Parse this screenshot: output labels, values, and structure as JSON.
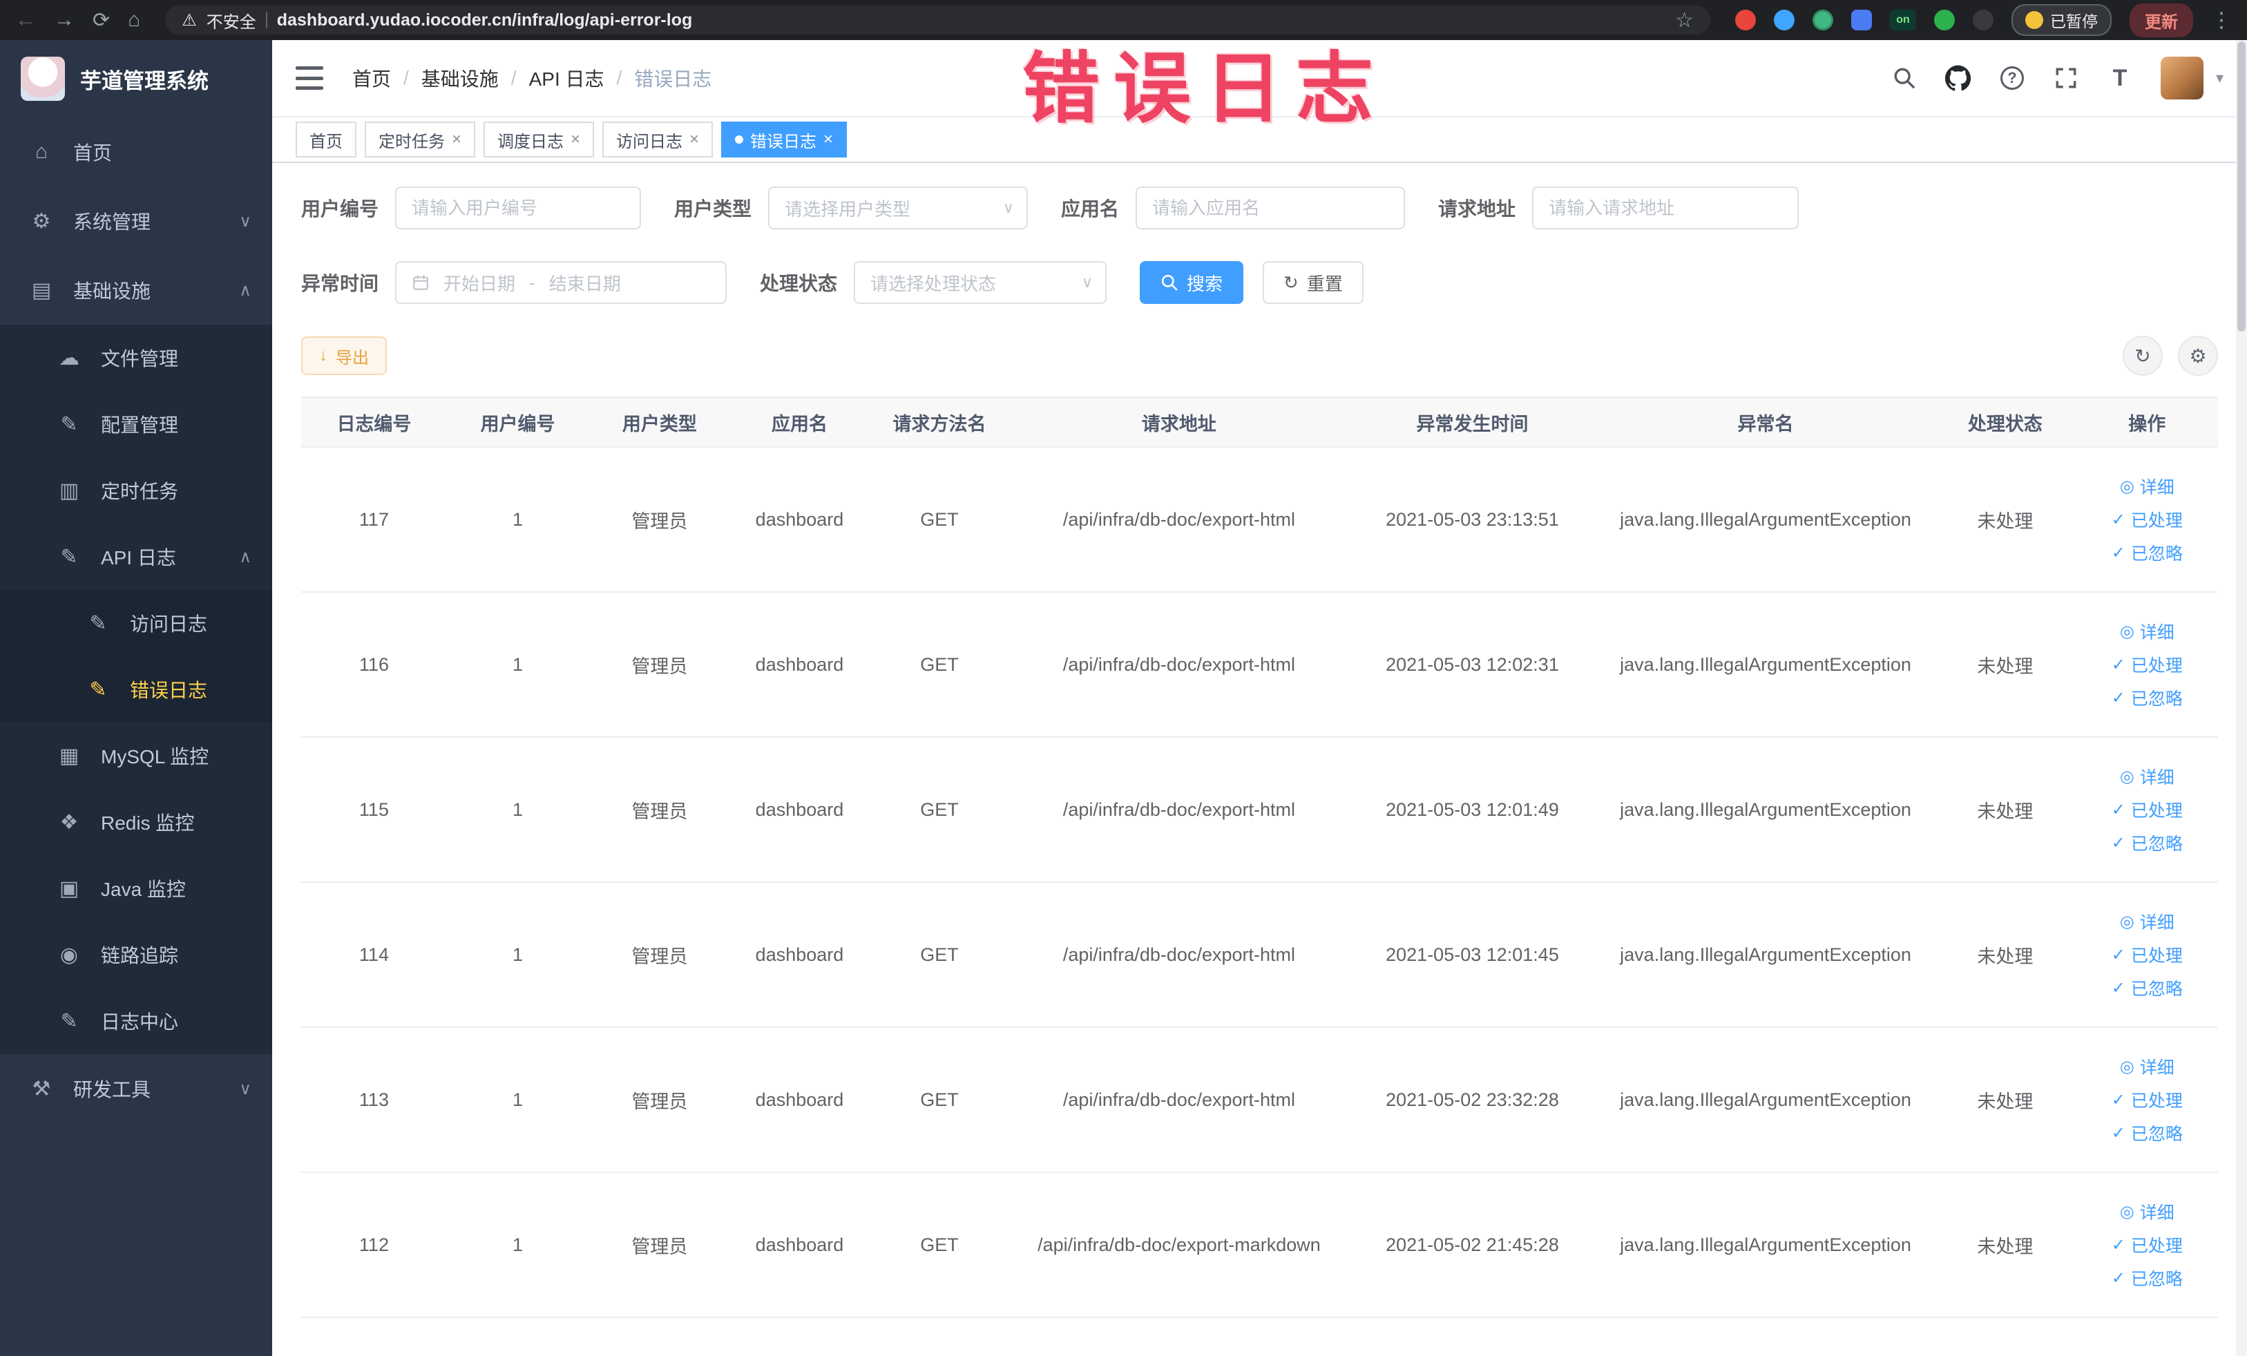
{
  "browser": {
    "security_label": "不安全",
    "url": "dashboard.yudao.iocoder.cn/infra/log/api-error-log",
    "ext_on_label": "on",
    "paused_label": "已暂停",
    "update_label": "更新"
  },
  "annotation": {
    "text": "错误日志"
  },
  "sidebar": {
    "title": "芋道管理系统",
    "items": [
      {
        "label": "首页"
      },
      {
        "label": "系统管理"
      },
      {
        "label": "基础设施"
      },
      {
        "label": "文件管理"
      },
      {
        "label": "配置管理"
      },
      {
        "label": "定时任务"
      },
      {
        "label": "API 日志"
      },
      {
        "label": "访问日志"
      },
      {
        "label": "错误日志"
      },
      {
        "label": "MySQL 监控"
      },
      {
        "label": "Redis 监控"
      },
      {
        "label": "Java 监控"
      },
      {
        "label": "链路追踪"
      },
      {
        "label": "日志中心"
      },
      {
        "label": "研发工具"
      }
    ]
  },
  "breadcrumb": {
    "items": [
      "首页",
      "基础设施",
      "API 日志",
      "错误日志"
    ],
    "separator": "/"
  },
  "tabs": [
    {
      "label": "首页"
    },
    {
      "label": "定时任务"
    },
    {
      "label": "调度日志"
    },
    {
      "label": "访问日志"
    },
    {
      "label": "错误日志"
    }
  ],
  "filters": {
    "user_id_label": "用户编号",
    "user_id_placeholder": "请输入用户编号",
    "user_type_label": "用户类型",
    "user_type_placeholder": "请选择用户类型",
    "app_name_label": "应用名",
    "app_name_placeholder": "请输入应用名",
    "request_url_label": "请求地址",
    "request_url_placeholder": "请输入请求地址",
    "exception_time_label": "异常时间",
    "start_placeholder": "开始日期",
    "range_separator": "-",
    "end_placeholder": "结束日期",
    "status_label": "处理状态",
    "status_placeholder": "请选择处理状态",
    "search_label": "搜索",
    "reset_label": "重置"
  },
  "toolbar": {
    "export_label": "导出"
  },
  "table": {
    "columns": [
      "日志编号",
      "用户编号",
      "用户类型",
      "应用名",
      "请求方法名",
      "请求地址",
      "异常发生时间",
      "异常名",
      "处理状态",
      "操作"
    ],
    "rows": [
      {
        "id": "117",
        "user_id": "1",
        "user_type": "管理员",
        "app": "dashboard",
        "method": "GET",
        "url": "/api/infra/db-doc/export-html",
        "time": "2021-05-03 23:13:51",
        "exception": "java.lang.IllegalArgumentException",
        "status": "未处理"
      },
      {
        "id": "116",
        "user_id": "1",
        "user_type": "管理员",
        "app": "dashboard",
        "method": "GET",
        "url": "/api/infra/db-doc/export-html",
        "time": "2021-05-03 12:02:31",
        "exception": "java.lang.IllegalArgumentException",
        "status": "未处理"
      },
      {
        "id": "115",
        "user_id": "1",
        "user_type": "管理员",
        "app": "dashboard",
        "method": "GET",
        "url": "/api/infra/db-doc/export-html",
        "time": "2021-05-03 12:01:49",
        "exception": "java.lang.IllegalArgumentException",
        "status": "未处理"
      },
      {
        "id": "114",
        "user_id": "1",
        "user_type": "管理员",
        "app": "dashboard",
        "method": "GET",
        "url": "/api/infra/db-doc/export-html",
        "time": "2021-05-03 12:01:45",
        "exception": "java.lang.IllegalArgumentException",
        "status": "未处理"
      },
      {
        "id": "113",
        "user_id": "1",
        "user_type": "管理员",
        "app": "dashboard",
        "method": "GET",
        "url": "/api/infra/db-doc/export-html",
        "time": "2021-05-02 23:32:28",
        "exception": "java.lang.IllegalArgumentException",
        "status": "未处理"
      },
      {
        "id": "112",
        "user_id": "1",
        "user_type": "管理员",
        "app": "dashboard",
        "method": "GET",
        "url": "/api/infra/db-doc/export-markdown",
        "time": "2021-05-02 21:45:28",
        "exception": "java.lang.IllegalArgumentException",
        "status": "未处理"
      }
    ],
    "actions": {
      "detail": "详细",
      "processed": "已处理",
      "ignored": "已忽略"
    }
  },
  "glyphs": {
    "back": "←",
    "forward": "→",
    "reload": "⟳",
    "home": "⌂",
    "warning": "⚠",
    "star": "☆",
    "kebab": "⋮",
    "gear": "⚙",
    "infra": "▤",
    "cloud": "☁",
    "edit": "✎",
    "list": "▥",
    "grid": "▦",
    "layers": "❖",
    "monitor": "▣",
    "eye": "◉",
    "tools": "⚒",
    "chevron_down": "∨",
    "chevron_up": "∧",
    "close": "×",
    "check": "✓",
    "detail_eye": "◎",
    "caret_down": "▾",
    "download": "↓",
    "refresh": "↻",
    "help": "?",
    "font_size": "T"
  },
  "colors": {
    "accent": "#409eff",
    "menu_active_text": "#ffd04b",
    "export_warning": "#e6a23c",
    "annotation_red": "#ee4362",
    "sidebar_bg": "#2a3648"
  }
}
